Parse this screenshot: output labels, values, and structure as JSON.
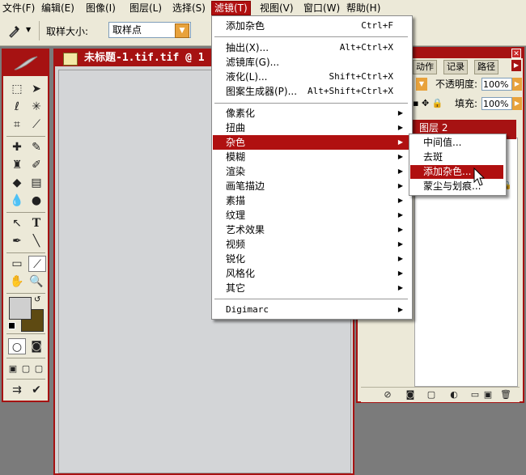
{
  "menubar": {
    "items": [
      {
        "label": "文件(F)"
      },
      {
        "label": "编辑(E)"
      },
      {
        "label": "图像(I)"
      },
      {
        "label": "图层(L)"
      },
      {
        "label": "选择(S)"
      },
      {
        "label": "滤镜(T)"
      },
      {
        "label": "视图(V)"
      },
      {
        "label": "窗口(W)"
      },
      {
        "label": "帮助(H)"
      }
    ],
    "active_index": 5
  },
  "options_bar": {
    "sample_size_label": "取样大小:",
    "sample_size_value": "取样点"
  },
  "document": {
    "title": "未标题-1.tif.tif @ 1"
  },
  "layers_panel": {
    "tabs": [
      "动作",
      "记录",
      "路径"
    ],
    "opacity_label": "不透明度:",
    "opacity_value": "100%",
    "fill_label": "填充:",
    "fill_value": "100%",
    "layer_name": "图层 2"
  },
  "filter_menu": {
    "last_filter": {
      "label": "添加杂色",
      "shortcut": "Ctrl+F"
    },
    "group2": [
      {
        "label": "抽出(X)...",
        "shortcut": "Alt+Ctrl+X"
      },
      {
        "label": "滤镜库(G)..."
      },
      {
        "label": "液化(L)...",
        "shortcut": "Shift+Ctrl+X"
      },
      {
        "label": "图案生成器(P)...",
        "shortcut": "Alt+Shift+Ctrl+X"
      }
    ],
    "submenus": [
      {
        "label": "像素化"
      },
      {
        "label": "扭曲"
      },
      {
        "label": "杂色"
      },
      {
        "label": "模糊"
      },
      {
        "label": "渲染"
      },
      {
        "label": "画笔描边"
      },
      {
        "label": "素描"
      },
      {
        "label": "纹理"
      },
      {
        "label": "艺术效果"
      },
      {
        "label": "视频"
      },
      {
        "label": "锐化"
      },
      {
        "label": "风格化"
      },
      {
        "label": "其它"
      }
    ],
    "digimarc": "Digimarc",
    "highlighted_index": 2
  },
  "noise_submenu": {
    "items": [
      {
        "label": "中间值..."
      },
      {
        "label": "去斑"
      },
      {
        "label": "添加杂色..."
      },
      {
        "label": "蒙尘与划痕..."
      }
    ],
    "highlighted_index": 2
  },
  "colors": {
    "accent": "#a61212",
    "menu_highlight": "#b01010",
    "foreground": "#cfcfcf",
    "background": "#5e4a12"
  }
}
